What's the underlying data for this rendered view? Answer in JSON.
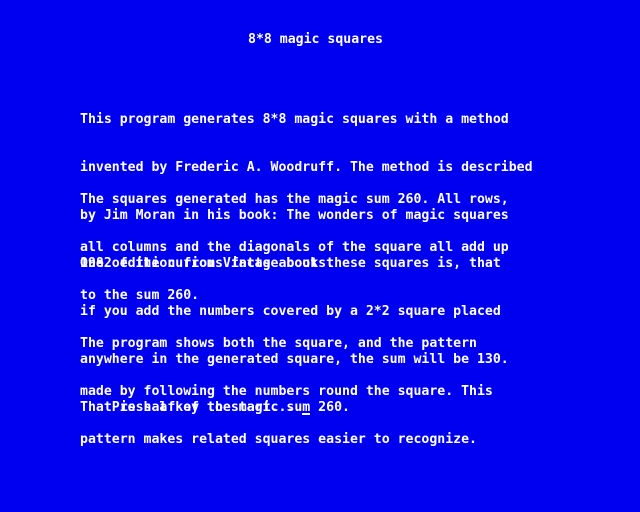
{
  "screen": {
    "title": "8*8 magic squares",
    "paragraph1": [
      "This program generates 8*8 magic squares with a method",
      "invented by Frederic A. Woodruff. The method is described",
      "by Jim Moran in his book: The wonders of magic squares",
      "1982 edition from Vintage books."
    ],
    "paragraph2": [
      "The squares generated has the magic sum 260. All rows,",
      "all columns and the diagonals of the square all add up",
      "to the sum 260."
    ],
    "paragraph3": [
      "One of the curious facts about these squares is, that",
      "if you add the numbers covered by a 2*2 square placed",
      "anywhere in the generated square, the sum will be 130.",
      "That is half of the magic sum 260."
    ],
    "paragraph4": [
      "The program shows both the square, and the pattern",
      "made by following the numbers round the square. This",
      "pattern makes related squares easier to recognize."
    ],
    "prompt": "Press a key to start... ",
    "cursor_icon": "underscore-cursor-icon"
  },
  "colors": {
    "background": "#0000f0",
    "text": "#ffffff"
  }
}
